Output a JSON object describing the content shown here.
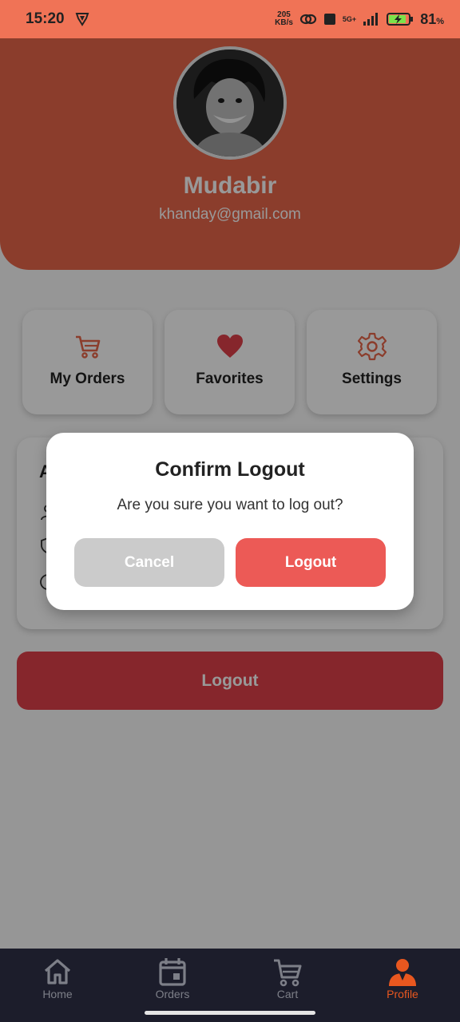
{
  "status_bar": {
    "time": "15:20",
    "net_speed_value": "205",
    "net_speed_unit": "KB/s",
    "signal_label": "5G+",
    "battery_percent": "81",
    "battery_symbol": "%"
  },
  "profile": {
    "name": "Mudabir",
    "email": "khanday@gmail.com"
  },
  "quick_actions": [
    {
      "label": "My Orders",
      "icon": "cart-icon"
    },
    {
      "label": "Favorites",
      "icon": "heart-icon"
    },
    {
      "label": "Settings",
      "icon": "gear-icon"
    }
  ],
  "account": {
    "title": "A"
  },
  "logout_button": {
    "label": "Logout"
  },
  "dialog": {
    "title": "Confirm Logout",
    "message": "Are you sure you want to log out?",
    "cancel_label": "Cancel",
    "confirm_label": "Logout"
  },
  "bottom_nav": {
    "items": [
      {
        "label": "Home",
        "icon": "home-icon"
      },
      {
        "label": "Orders",
        "icon": "calendar-icon"
      },
      {
        "label": "Cart",
        "icon": "cart-icon"
      },
      {
        "label": "Profile",
        "icon": "profile-icon"
      }
    ],
    "active_index": 3
  },
  "colors": {
    "accent": "#e8664a",
    "status_bar": "#f07356",
    "danger": "#e0404a",
    "nav_background": "#1c1d2b",
    "nav_active": "#e8571f"
  }
}
